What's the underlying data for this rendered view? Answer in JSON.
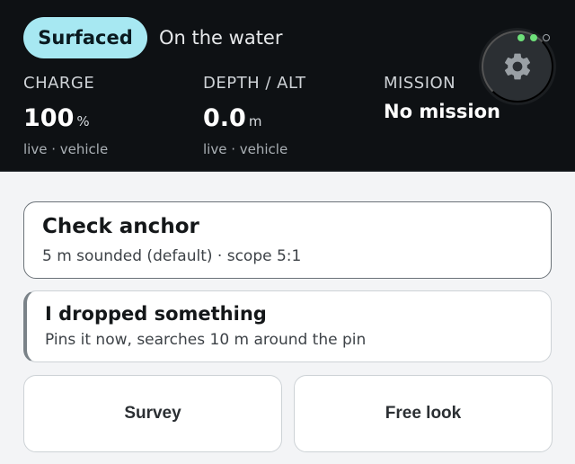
{
  "status": {
    "pill": "Surfaced",
    "text": "On the water"
  },
  "stats": {
    "charge": {
      "label": "CHARGE",
      "value": "100",
      "unit": "%",
      "source": "live · vehicle"
    },
    "depth": {
      "label": "DEPTH / ALT",
      "value": "0.0",
      "unit": "m",
      "source": "live · vehicle"
    },
    "mission": {
      "label": "MISSION",
      "value": "No mission"
    }
  },
  "indicators": [
    "on",
    "on",
    "off"
  ],
  "icons": {
    "settings": "gear-icon"
  },
  "actions": {
    "anchor": {
      "title": "Check anchor",
      "subtitle": "5 m sounded (default) · scope 5:1"
    },
    "dropped": {
      "title": "I dropped something",
      "subtitle": "Pins it now, searches 10 m around the pin"
    },
    "survey": "Survey",
    "free_look": "Free look"
  },
  "colors": {
    "pill": "#a7e8f2",
    "indicator_on": "#6ee07a",
    "header_bg": "#0e1114"
  }
}
